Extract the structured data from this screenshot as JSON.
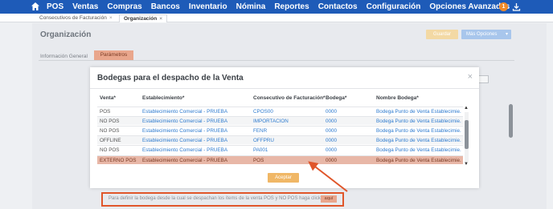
{
  "nav": {
    "items": [
      "POS",
      "Ventas",
      "Compras",
      "Bancos",
      "Inventario",
      "Nómina",
      "Reportes",
      "Contactos",
      "Configuración",
      "Opciones Avanzadas"
    ],
    "notification_count": "1",
    "color": "#1e5bb8"
  },
  "tabs": [
    {
      "label": "Consecutivos de Facturación",
      "close": "×"
    },
    {
      "label": "Organización",
      "close": "×"
    }
  ],
  "page": {
    "title": "Organización",
    "save_label": "Guardar",
    "more_label": "Más Opciones",
    "subtabs": [
      "Información General",
      "Parámetros"
    ]
  },
  "modal": {
    "title": "Bodegas para el despacho de la Venta",
    "close": "×",
    "columns": [
      "Venta*",
      "Establecimiento*",
      "Consecutivo de Facturación*",
      "Bodega*",
      "Nombre Bodega*"
    ],
    "rows": [
      {
        "venta": "POS",
        "est": "Establecimiento Comercial - PRUEBA",
        "cons": "CPOS00",
        "bodega": "0000",
        "nombre": "Bodega Punto de Venta Establecimie..."
      },
      {
        "venta": "NO POS",
        "est": "Establecimiento Comercial - PRUEBA",
        "cons": "IMPORTACION",
        "bodega": "0000",
        "nombre": "Bodega Punto de Venta Establecimie..."
      },
      {
        "venta": "NO POS",
        "est": "Establecimiento Comercial - PRUEBA",
        "cons": "FENR",
        "bodega": "0000",
        "nombre": "Bodega Punto de Venta Establecimie..."
      },
      {
        "venta": "OFFLINE",
        "est": "Establecimiento Comercial - PRUEBA",
        "cons": "OFFPRU",
        "bodega": "0000",
        "nombre": "Bodega Punto de Venta Establecimie..."
      },
      {
        "venta": "NO POS",
        "est": "Establecimiento Comercial - PRUEBA",
        "cons": "PA001",
        "bodega": "0000",
        "nombre": "Bodega Punto de Venta Establecimie..."
      },
      {
        "venta": "EXTERNO POS",
        "est": "Establecimiento Comercial - PRUEBA",
        "cons": "POS",
        "bodega": "0000",
        "nombre": "Bodega Punto de Venta Establecimie..."
      }
    ],
    "accept_label": "Aceptar"
  },
  "hint": {
    "text": "Para definir la bodega desde la cual se despachan los ítems de la venta POS y NO POS haga click",
    "button_label": "aquí"
  }
}
